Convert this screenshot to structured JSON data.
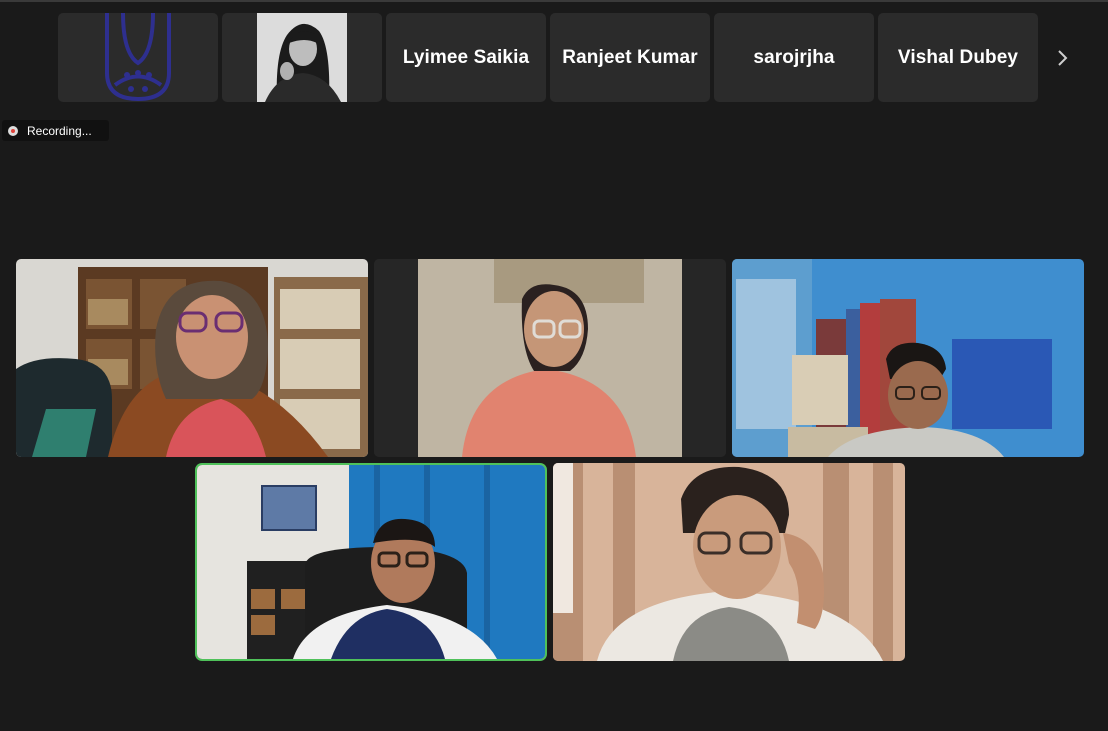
{
  "participants_strip": {
    "tiles": [
      {
        "type": "logo",
        "icon": "institution-logo-icon"
      },
      {
        "type": "photo",
        "icon": "profile-photo"
      },
      {
        "type": "name",
        "name": "Lyimee Saikia"
      },
      {
        "type": "name",
        "name": "Ranjeet Kumar"
      },
      {
        "type": "name",
        "name": "sarojrjha"
      },
      {
        "type": "name",
        "name": "Vishal Dubey"
      }
    ],
    "next_icon": "chevron-right-icon"
  },
  "recording": {
    "label": "Recording...",
    "icon": "record-dot-icon"
  },
  "gallery": {
    "videos": [
      {
        "id": "video-1",
        "active": false
      },
      {
        "id": "video-2",
        "active": false
      },
      {
        "id": "video-3",
        "active": false
      },
      {
        "id": "video-4",
        "active": true
      },
      {
        "id": "video-5",
        "active": false
      }
    ]
  },
  "colors": {
    "background": "#1a1a1a",
    "tile": "#2b2b2b",
    "active_speaker": "#4fc15a",
    "logo": "#2e2f8f",
    "recording_dot": "#e0443c"
  }
}
